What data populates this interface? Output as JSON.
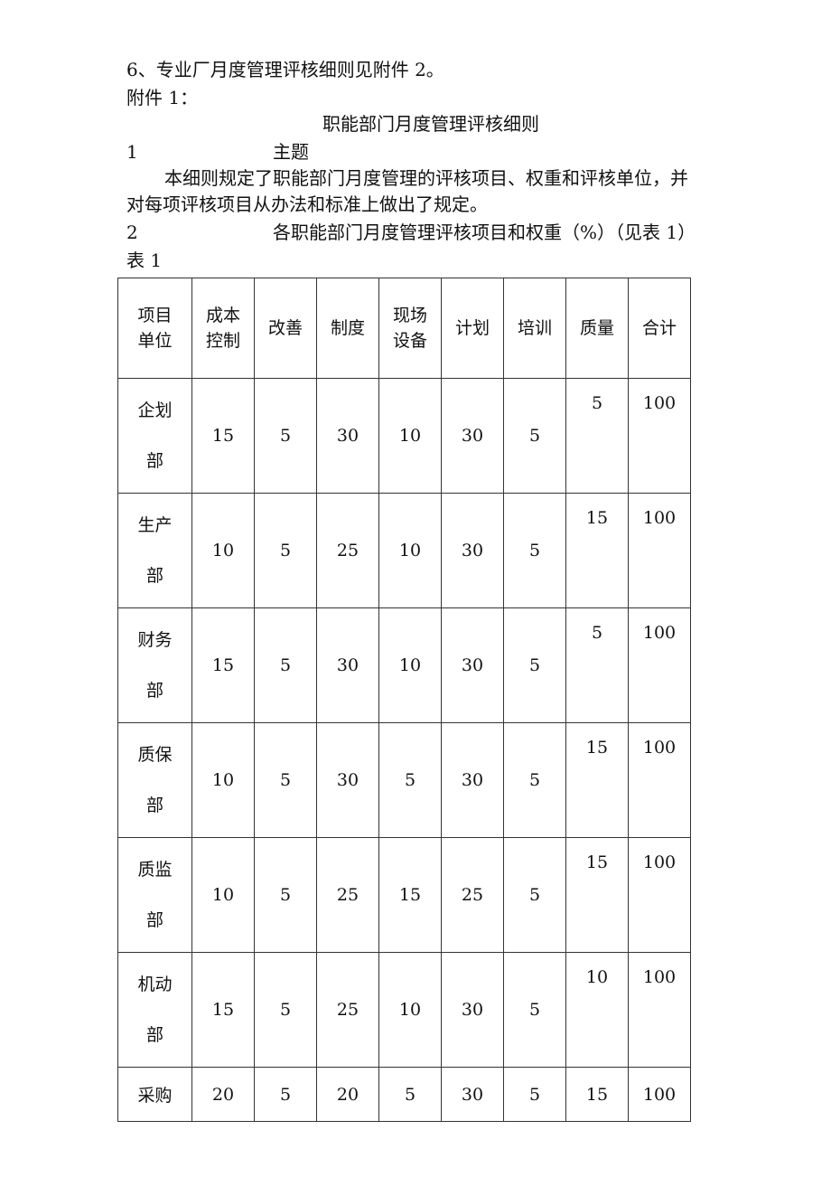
{
  "lines": {
    "item6": "6、专业厂月度管理评核细则见附件 2。",
    "attachment": "附件 1：",
    "title": "职能部门月度管理评核细则",
    "section1_num": "1",
    "section1_title": "主题",
    "para1_line1": "本细则规定了职能部门月度管理的评核项目、权重和评核单位，并",
    "para1_line2": "对每项评核项目从办法和标准上做出了规定。",
    "section2_num": "2",
    "section2_title": "各职能部门月度管理评核项目和权重（%）（见表 1）",
    "table_label": "表 1"
  },
  "table": {
    "header": {
      "corner_top": "项目",
      "corner_bottom": "单位",
      "columns": [
        {
          "top": "成本",
          "bottom": "控制"
        },
        {
          "top": "改善",
          "bottom": ""
        },
        {
          "top": "制度",
          "bottom": ""
        },
        {
          "top": "现场",
          "bottom": "设备"
        },
        {
          "top": "计划",
          "bottom": ""
        },
        {
          "top": "培训",
          "bottom": ""
        },
        {
          "top": "质量",
          "bottom": ""
        },
        {
          "top": "合计",
          "bottom": ""
        }
      ]
    },
    "rows": [
      {
        "unit_top": "企划",
        "unit_bottom": "部",
        "values": [
          "15",
          "5",
          "30",
          "10",
          "30",
          "5",
          "5",
          "100"
        ]
      },
      {
        "unit_top": "生产",
        "unit_bottom": "部",
        "values": [
          "10",
          "5",
          "25",
          "10",
          "30",
          "5",
          "15",
          "100"
        ]
      },
      {
        "unit_top": "财务",
        "unit_bottom": "部",
        "values": [
          "15",
          "5",
          "30",
          "10",
          "30",
          "5",
          "5",
          "100"
        ]
      },
      {
        "unit_top": "质保",
        "unit_bottom": "部",
        "values": [
          "10",
          "5",
          "30",
          "5",
          "30",
          "5",
          "15",
          "100"
        ]
      },
      {
        "unit_top": "质监",
        "unit_bottom": "部",
        "values": [
          "10",
          "5",
          "25",
          "15",
          "25",
          "5",
          "15",
          "100"
        ]
      },
      {
        "unit_top": "机动",
        "unit_bottom": "部",
        "values": [
          "15",
          "5",
          "25",
          "10",
          "30",
          "5",
          "10",
          "100"
        ]
      },
      {
        "unit_top": "采购",
        "unit_bottom": "",
        "values": [
          "20",
          "5",
          "20",
          "5",
          "30",
          "5",
          "15",
          "100"
        ]
      }
    ]
  }
}
